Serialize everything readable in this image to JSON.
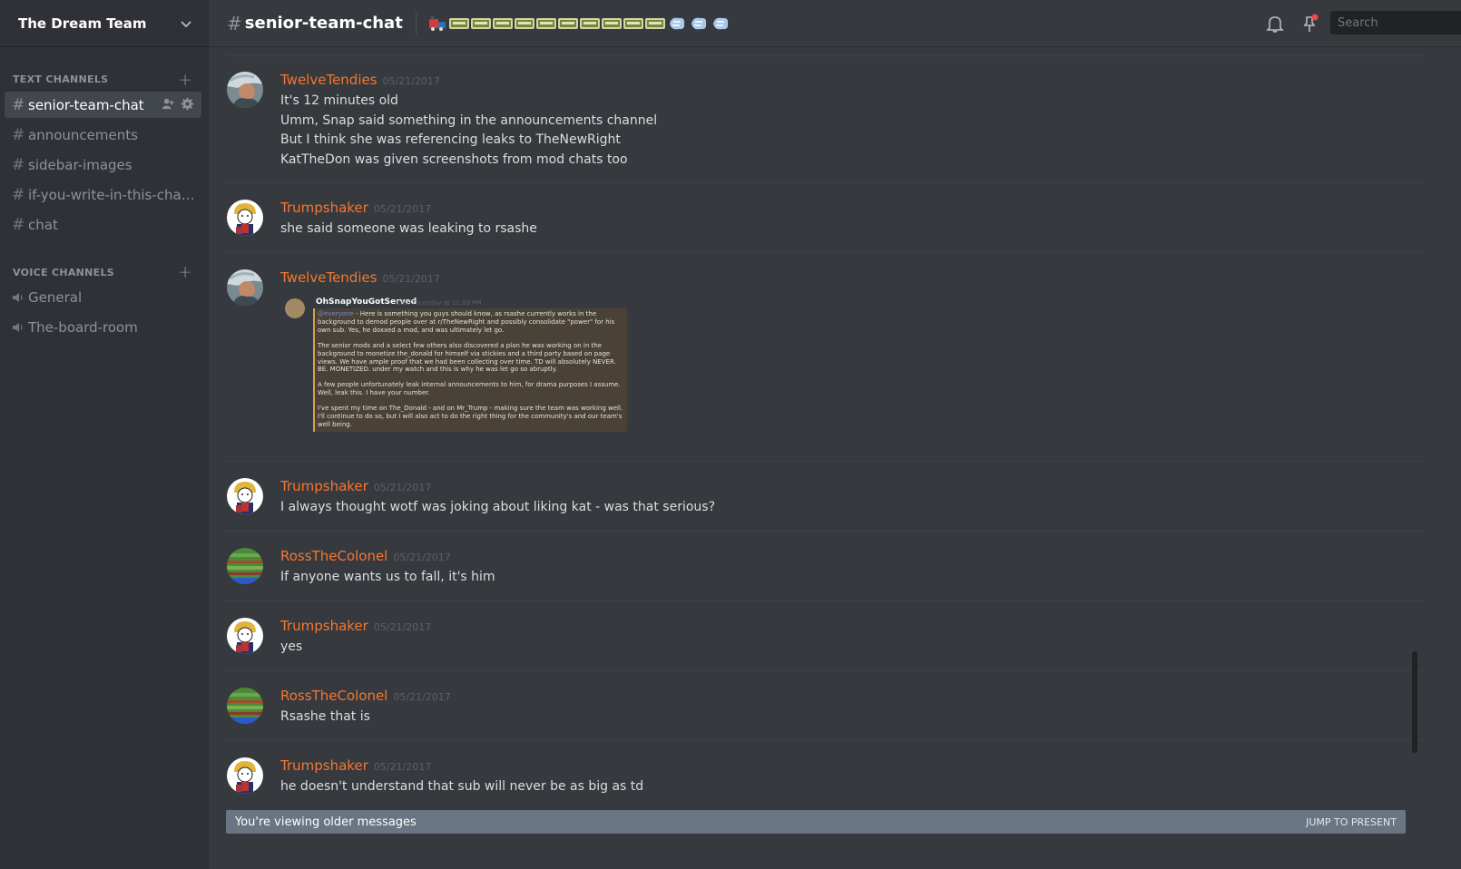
{
  "server": {
    "name": "The Dream Team"
  },
  "sidebar": {
    "text_category": "TEXT CHANNELS",
    "voice_category": "VOICE CHANNELS",
    "text_channels": [
      {
        "name": "senior-team-chat",
        "active": true
      },
      {
        "name": "announcements"
      },
      {
        "name": "sidebar-images"
      },
      {
        "name": "if-you-write-in-this-chann..."
      },
      {
        "name": "chat"
      }
    ],
    "voice_channels": [
      {
        "name": "General"
      },
      {
        "name": "The-board-room"
      }
    ]
  },
  "header": {
    "hash": "#",
    "channel": "senior-team-chat",
    "topic_icons": [
      "train-engine-emoji",
      "railway-car-emoji",
      "dash-emoji"
    ],
    "search_placeholder": "Search"
  },
  "messages": [
    {
      "author": "TwelveTendies",
      "time": "05/21/2017",
      "avatar": "painting-avatar",
      "lines": [
        "It's 12 minutes old",
        "Umm, Snap said something in the announcements channel",
        "But I think she was referencing leaks to TheNewRight",
        "KatTheDon was given screenshots from mod chats too"
      ]
    },
    {
      "author": "Trumpshaker",
      "time": "05/21/2017",
      "avatar": "cartoon-avatar",
      "lines": [
        "she said someone was leaking to rsashe"
      ]
    },
    {
      "author": "TwelveTendies",
      "time": "05/21/2017",
      "avatar": "painting-avatar",
      "embed": {
        "name": "OhSnapYouGotServed",
        "time": "Last Thursday at 11:03 PM",
        "mention": "@everyone",
        "paragraphs": [
          " - Here is something you guys should know, as rsashe currently works in the background to demod people over at r/TheNewRight and possibly consolidate \"power\" for his own sub. Yes, he doxxed a mod, and was ultimately let go.",
          "The senior mods and a select few others also discovered a plan he was working on in the background to monetize the_donald for himself via stickies and a third party based on page views. We have ample proof that we had been collecting over time. TD will absolutely NEVER. BE. MONETIZED. under my watch and this is why he was let go so abruptly.",
          "A few people unfortunately leak internal announcements to him, for drama purposes I assume. Well, leak this. I have your number.",
          "I've spent my time on The_Donald - and on Mr_Trump - making sure the team was working well. I'll continue to do so, but I will also act to do the right thing for the community's and our team's well being."
        ]
      }
    },
    {
      "author": "Trumpshaker",
      "time": "05/21/2017",
      "avatar": "cartoon-avatar",
      "lines": [
        "I always thought wotf was joking about liking kat - was that serious?"
      ]
    },
    {
      "author": "RossTheColonel",
      "time": "05/21/2017",
      "avatar": "striped-avatar",
      "lines": [
        "If anyone wants us to fall, it's him"
      ]
    },
    {
      "author": "Trumpshaker",
      "time": "05/21/2017",
      "avatar": "cartoon-avatar",
      "lines": [
        "yes"
      ]
    },
    {
      "author": "RossTheColonel",
      "time": "05/21/2017",
      "avatar": "striped-avatar",
      "lines": [
        "Rsashe that is"
      ]
    },
    {
      "author": "Trumpshaker",
      "time": "05/21/2017",
      "avatar": "cartoon-avatar",
      "lines": [
        "he doesn't understand that sub will never be as big as td"
      ]
    }
  ],
  "older_bar": {
    "text": "You're viewing older messages",
    "jump": "JUMP TO PRESENT"
  },
  "colors": {
    "author": "#f57731",
    "sidebar": "#2f3136",
    "chat": "#36393e",
    "older_bar": "#697582"
  }
}
